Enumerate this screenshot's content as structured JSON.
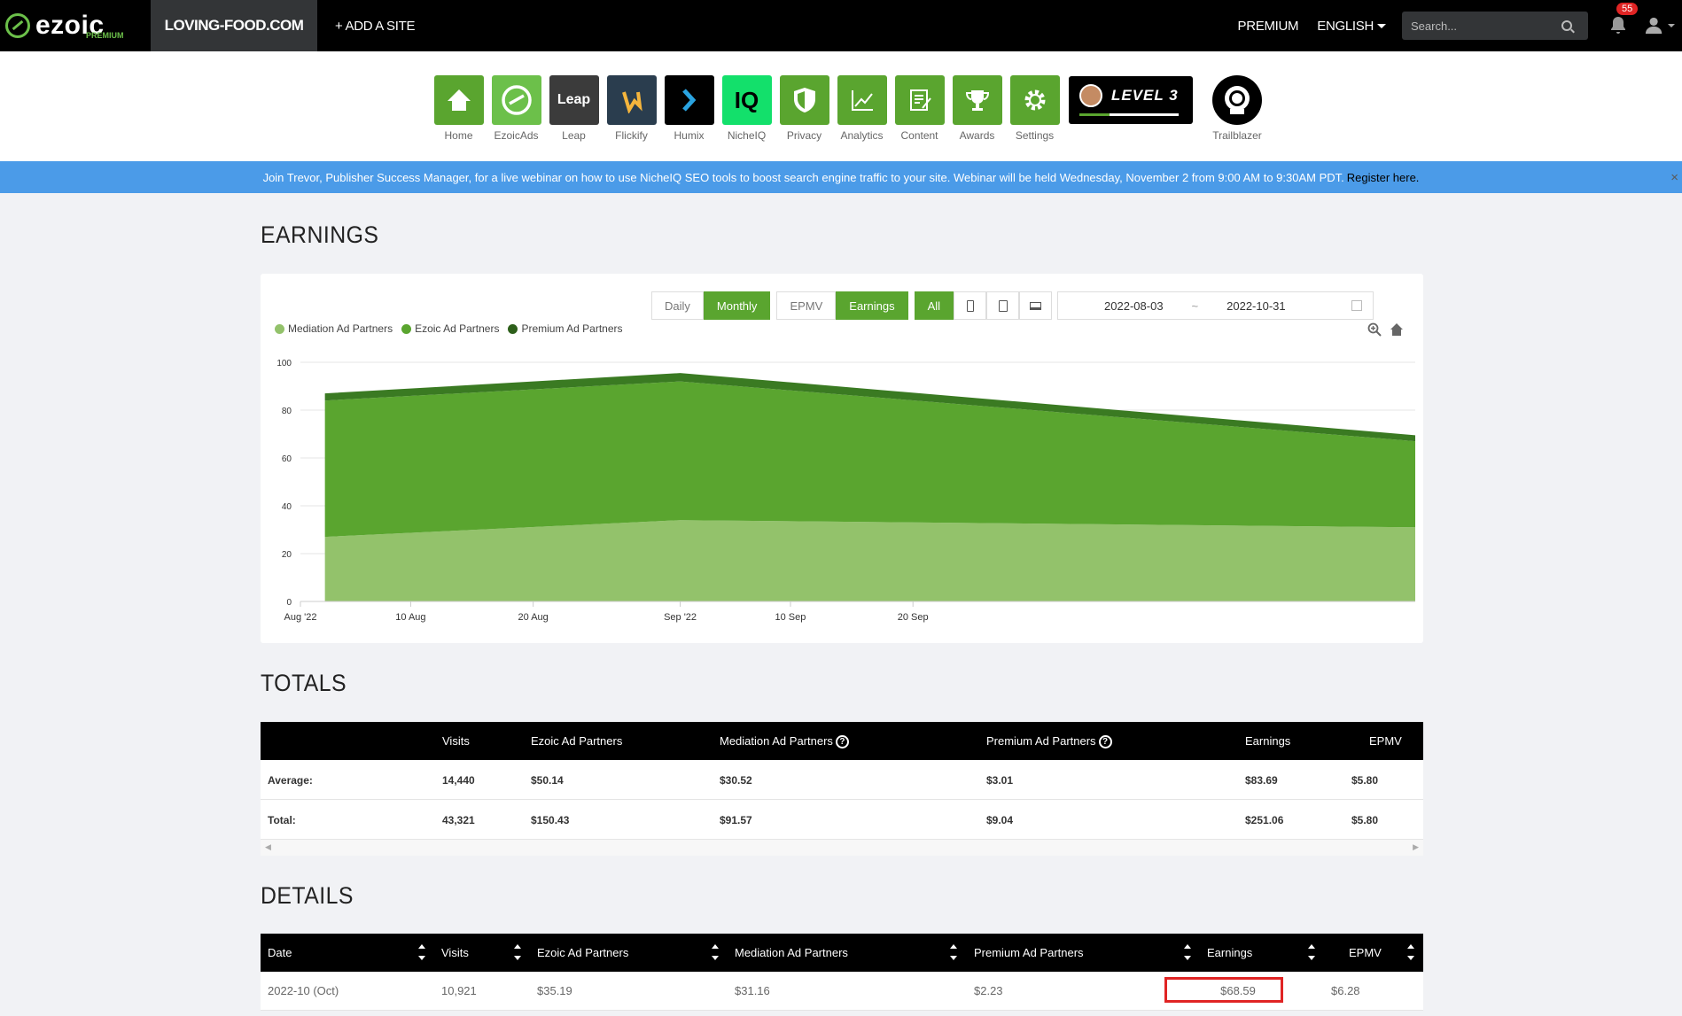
{
  "topbar": {
    "logo_text": "ezoic",
    "logo_sub": "PREMIUM",
    "site_name": "LOVING-FOOD.COM",
    "add_site": "+ ADD A SITE",
    "premium": "PREMIUM",
    "language": "ENGLISH",
    "search_placeholder": "Search...",
    "notification_count": "55"
  },
  "apps": [
    {
      "label": "Home",
      "icon": "home-icon"
    },
    {
      "label": "EzoicAds",
      "icon": "ezoicads-icon"
    },
    {
      "label": "Leap",
      "icon": "leap-icon"
    },
    {
      "label": "Flickify",
      "icon": "flickify-icon"
    },
    {
      "label": "Humix",
      "icon": "humix-icon"
    },
    {
      "label": "NicheIQ",
      "icon": "nicheiq-icon"
    },
    {
      "label": "Privacy",
      "icon": "shield-icon"
    },
    {
      "label": "Analytics",
      "icon": "chart-icon"
    },
    {
      "label": "Content",
      "icon": "document-icon"
    },
    {
      "label": "Awards",
      "icon": "trophy-icon"
    },
    {
      "label": "Settings",
      "icon": "gear-icon"
    }
  ],
  "app_tile_text": {
    "leap": "Leap",
    "iq": "IQ"
  },
  "level": {
    "text": "LEVEL 3",
    "progress": 0.3
  },
  "trailblazer": "Trailblazer",
  "banner": {
    "text": "Join Trevor, Publisher Success Manager, for a live webinar on how to use NicheIQ SEO tools to boost search engine traffic to your site. Webinar will be held Wednesday, November 2 from 9:00 AM to 9:30AM PDT.",
    "link": "Register here.",
    "close": "×"
  },
  "earnings": {
    "title": "EARNINGS",
    "buttons": {
      "daily": "Daily",
      "monthly": "Monthly",
      "epmv": "EPMV",
      "earnings": "Earnings",
      "all": "All"
    },
    "date_from": "2022-08-03",
    "date_sep": "~",
    "date_to": "2022-10-31"
  },
  "chart_data": {
    "type": "area",
    "stacked": true,
    "x": [
      "2022-08-03",
      "2022-09-01",
      "2022-10-31"
    ],
    "series": [
      {
        "name": "Mediation Ad Partners",
        "color": "#93c26b",
        "values": [
          27,
          34,
          31
        ]
      },
      {
        "name": "Ezoic Ad Partners",
        "color": "#5aa52f",
        "values": [
          57,
          58,
          36
        ]
      },
      {
        "name": "Premium Ad Partners",
        "color": "#3a7a22",
        "values": [
          3,
          3.5,
          2.5
        ]
      }
    ],
    "ylim": [
      0,
      100
    ],
    "y_ticks": [
      "0",
      "20",
      "40",
      "60",
      "80",
      "100"
    ],
    "x_ticks": [
      {
        "label": "Aug '22",
        "date": "2022-08-01"
      },
      {
        "label": "10 Aug",
        "date": "2022-08-10"
      },
      {
        "label": "20 Aug",
        "date": "2022-08-20"
      },
      {
        "label": "Sep '22",
        "date": "2022-09-01"
      },
      {
        "label": "10 Sep",
        "date": "2022-09-10"
      },
      {
        "label": "20 Sep",
        "date": "2022-09-20"
      }
    ],
    "grid": true,
    "legend": "top-left"
  },
  "totals": {
    "title": "TOTALS",
    "headers": [
      "Visits",
      "Ezoic Ad Partners",
      "Mediation Ad Partners",
      "Premium Ad Partners",
      "Earnings",
      "EPMV"
    ],
    "rows": [
      {
        "label": "Average:",
        "visits": "14,440",
        "ezoic": "$50.14",
        "mediation": "$30.52",
        "premium": "$3.01",
        "earnings": "$83.69",
        "epmv": "$5.80"
      },
      {
        "label": "Total:",
        "visits": "43,321",
        "ezoic": "$150.43",
        "mediation": "$91.57",
        "premium": "$9.04",
        "earnings": "$251.06",
        "epmv": "$5.80"
      }
    ]
  },
  "details": {
    "title": "DETAILS",
    "headers": [
      "Date",
      "Visits",
      "Ezoic Ad Partners",
      "Mediation Ad Partners",
      "Premium Ad Partners",
      "Earnings",
      "EPMV"
    ],
    "rows": [
      {
        "date": "2022-10 (Oct)",
        "visits": "10,921",
        "ezoic": "$35.19",
        "mediation": "$31.16",
        "premium": "$2.23",
        "earnings": "$68.59",
        "epmv": "$6.28"
      }
    ]
  }
}
